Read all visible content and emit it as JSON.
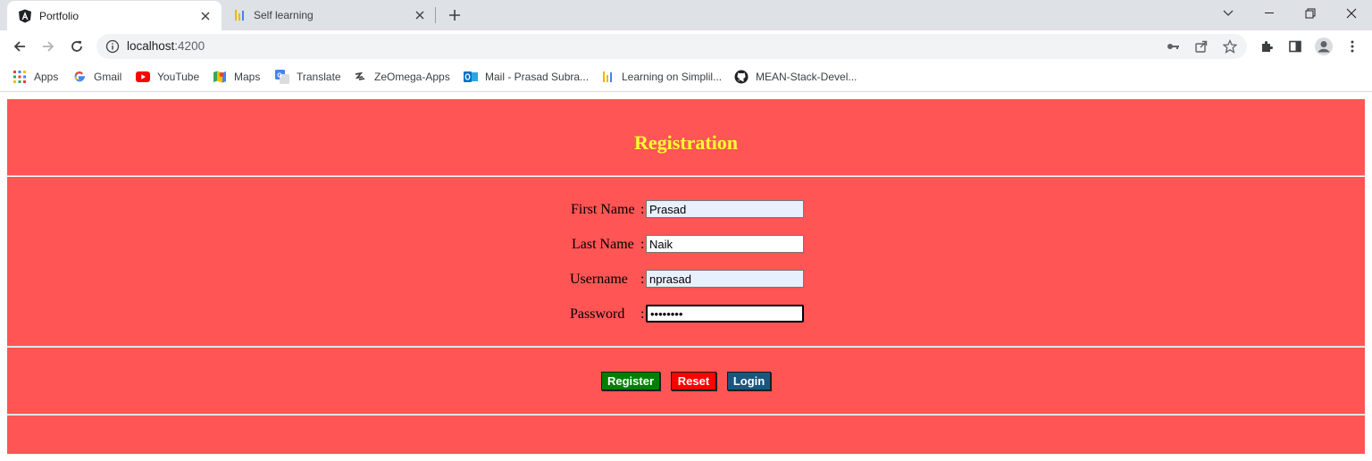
{
  "browser": {
    "tabs": [
      {
        "title": "Portfolio",
        "active": true
      },
      {
        "title": "Self learning",
        "active": false
      }
    ],
    "address": {
      "host": "localhost",
      "port": ":4200"
    },
    "bookmarks": [
      {
        "label": "Apps",
        "icon": "apps-grid-icon"
      },
      {
        "label": "Gmail",
        "icon": "google-icon"
      },
      {
        "label": "YouTube",
        "icon": "youtube-icon"
      },
      {
        "label": "Maps",
        "icon": "maps-icon"
      },
      {
        "label": "Translate",
        "icon": "translate-icon"
      },
      {
        "label": "ZeOmega-Apps",
        "icon": "zeomega-icon"
      },
      {
        "label": "Mail - Prasad Subra...",
        "icon": "outlook-icon"
      },
      {
        "label": "Learning on Simplil...",
        "icon": "simplilearn-icon"
      },
      {
        "label": "MEAN-Stack-Devel...",
        "icon": "github-icon"
      }
    ]
  },
  "form": {
    "heading": "Registration",
    "fields": [
      {
        "label": "First Name",
        "colon": ":",
        "value": "Prasad"
      },
      {
        "label": "Last Name",
        "colon": ":",
        "value": "Naik"
      },
      {
        "label": "Username",
        "colon": ":",
        "value": "nprasad"
      },
      {
        "label": "Password",
        "colon": ":",
        "value": "••••••••"
      }
    ],
    "buttons": {
      "register": "Register",
      "reset": "Reset",
      "login": "Login"
    }
  },
  "colors": {
    "page_bg": "#ff5555",
    "heading": "#ffff33",
    "register": "#008000",
    "reset": "#ff0000",
    "login": "#1a5680"
  }
}
